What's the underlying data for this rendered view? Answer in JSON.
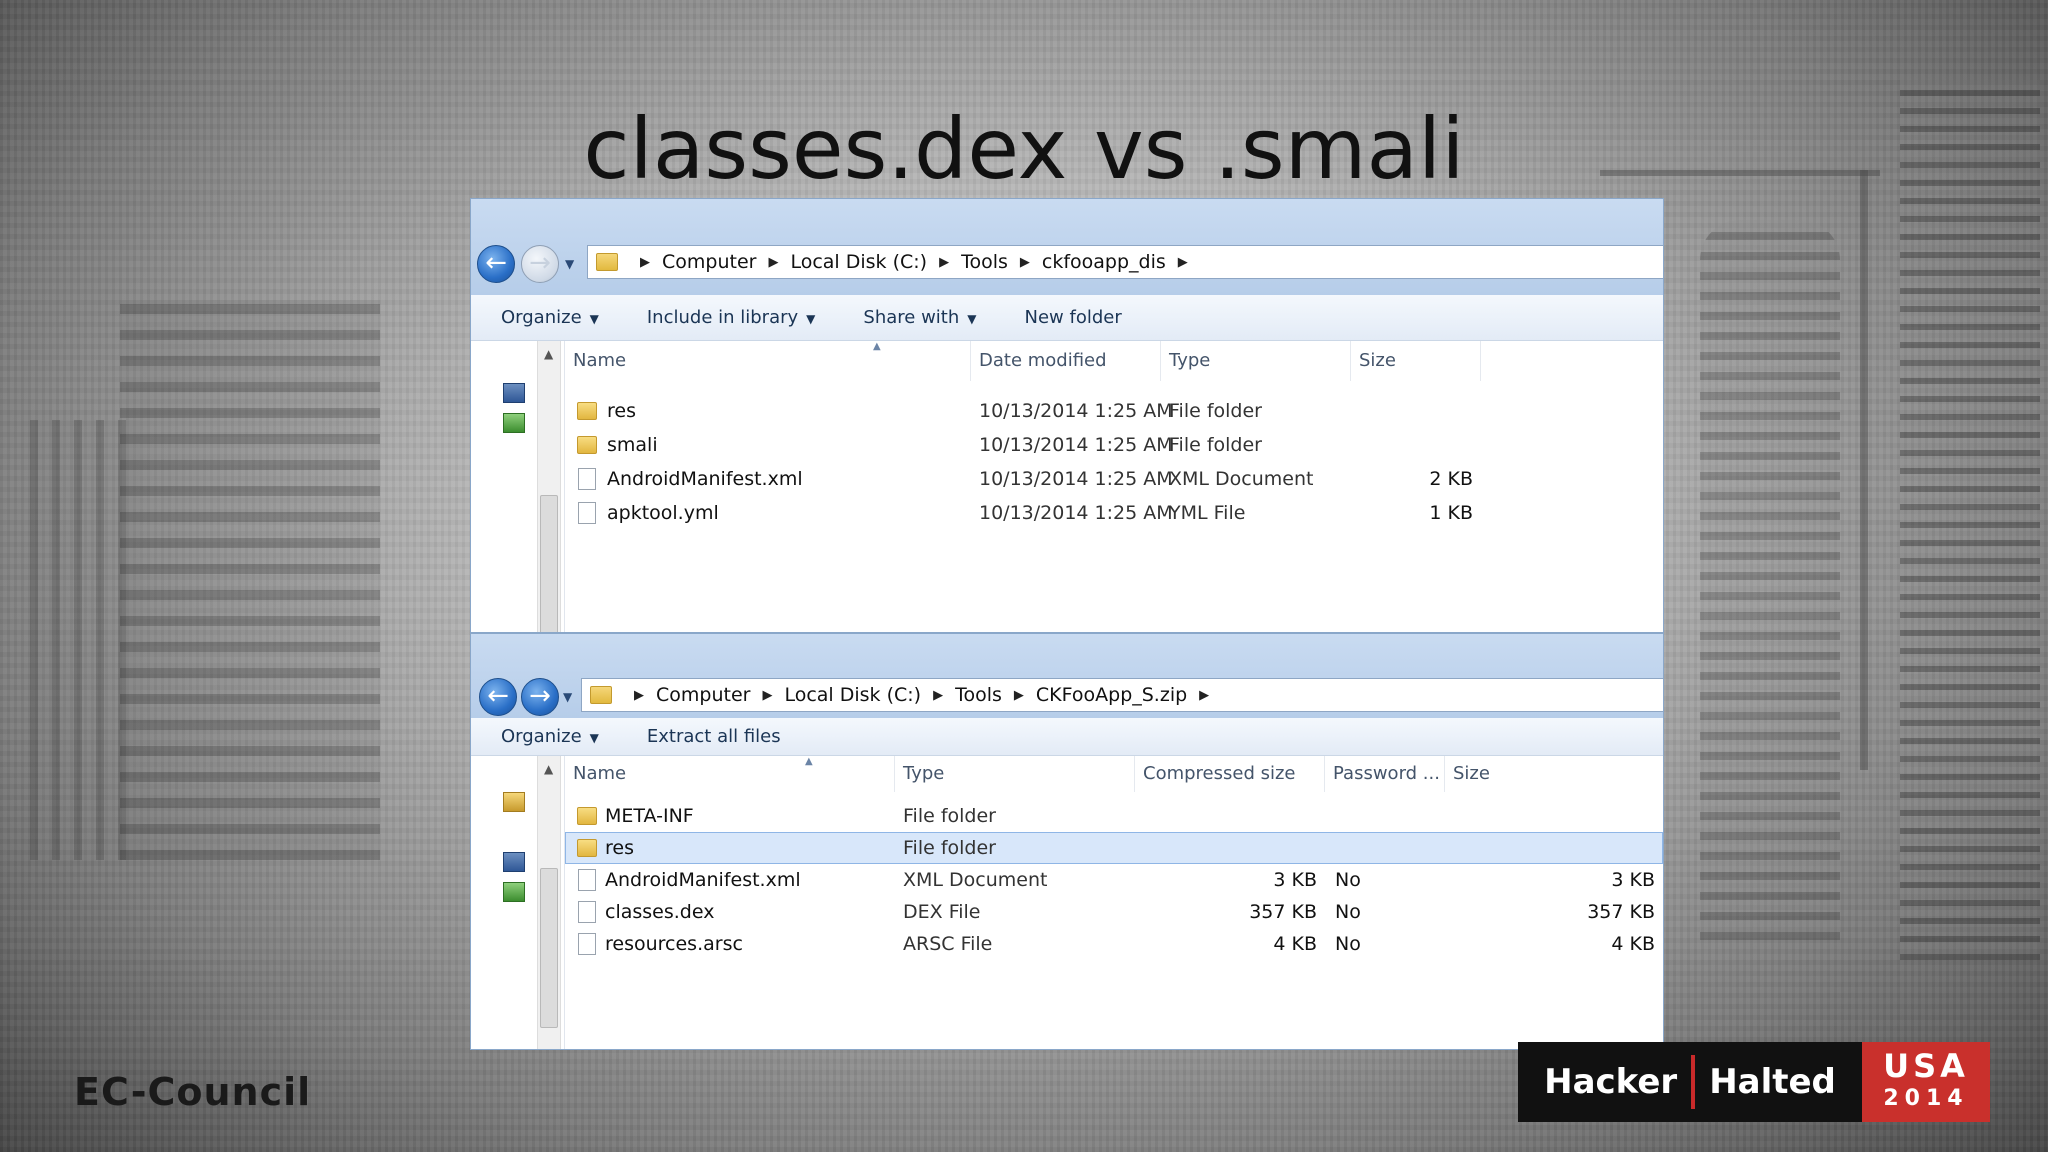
{
  "slide": {
    "title": "classes.dex vs .smali"
  },
  "window_top": {
    "path": [
      "Computer",
      "Local Disk (C:)",
      "Tools",
      "ckfooapp_dis"
    ],
    "commands": [
      "Organize",
      "Include in library",
      "Share with",
      "New folder"
    ],
    "columns": [
      "Name",
      "Date modified",
      "Type",
      "Size"
    ],
    "rows": [
      {
        "name": "res",
        "icon": "folder-icon",
        "date": "10/13/2014 1:25 AM",
        "type": "File folder",
        "size": ""
      },
      {
        "name": "smali",
        "icon": "folder-icon",
        "date": "10/13/2014 1:25 AM",
        "type": "File folder",
        "size": ""
      },
      {
        "name": "AndroidManifest.xml",
        "icon": "file-icon",
        "date": "10/13/2014 1:25 AM",
        "type": "XML Document",
        "size": "2 KB"
      },
      {
        "name": "apktool.yml",
        "icon": "file-icon",
        "date": "10/13/2014 1:25 AM",
        "type": "YML File",
        "size": "1 KB"
      }
    ]
  },
  "window_bottom": {
    "path": [
      "Computer",
      "Local Disk (C:)",
      "Tools",
      "CKFooApp_S.zip"
    ],
    "commands": [
      "Organize",
      "Extract all files"
    ],
    "columns": [
      "Name",
      "Type",
      "Compressed size",
      "Password ...",
      "Size"
    ],
    "rows": [
      {
        "name": "META-INF",
        "icon": "folder-icon",
        "type": "File folder",
        "compressed": "",
        "password": "",
        "size": ""
      },
      {
        "name": "res",
        "icon": "folder-icon",
        "type": "File folder",
        "compressed": "",
        "password": "",
        "size": "",
        "selected": true
      },
      {
        "name": "AndroidManifest.xml",
        "icon": "file-icon",
        "type": "XML Document",
        "compressed": "3 KB",
        "password": "No",
        "size": "3 KB"
      },
      {
        "name": "classes.dex",
        "icon": "file-icon",
        "type": "DEX File",
        "compressed": "357 KB",
        "password": "No",
        "size": "357 KB"
      },
      {
        "name": "resources.arsc",
        "icon": "file-icon",
        "type": "ARSC File",
        "compressed": "4 KB",
        "password": "No",
        "size": "4 KB"
      }
    ]
  },
  "branding": {
    "left_logo": "EC-Council",
    "right_hacker": "Hacker",
    "right_halted": "Halted",
    "right_usa": "USA",
    "right_year": "2014"
  },
  "colors": {
    "selection": "#d8e7fa",
    "chrome": "#c9dbf1",
    "brand_red": "#c9302c"
  }
}
